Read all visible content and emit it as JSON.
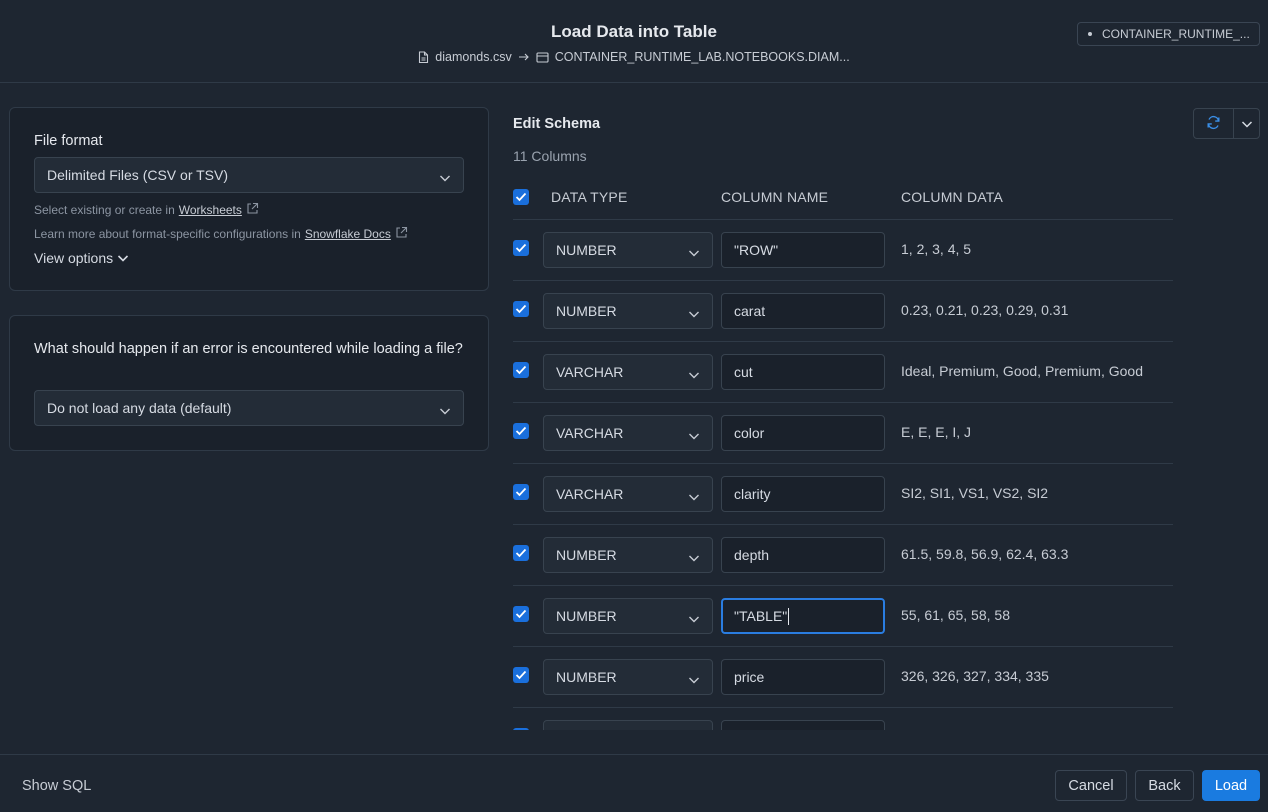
{
  "header": {
    "title": "Load Data into Table",
    "source_file": "diamonds.csv",
    "target_table": "CONTAINER_RUNTIME_LAB.NOTEBOOKS.DIAM...",
    "context_chip": "CONTAINER_RUNTIME_..."
  },
  "file_format": {
    "label": "File format",
    "selected": "Delimited Files (CSV or TSV)",
    "help1_prefix": "Select existing or create in",
    "help1_link": "Worksheets",
    "help2_prefix": "Learn more about format-specific configurations in",
    "help2_link": "Snowflake Docs",
    "view_options": "View options"
  },
  "error_handling": {
    "label": "What should happen if an error is encountered while loading a file?",
    "selected": "Do not load any data (default)"
  },
  "schema": {
    "title": "Edit Schema",
    "column_count": "11 Columns",
    "headers": {
      "data_type": "DATA TYPE",
      "column_name": "COLUMN NAME",
      "column_data": "COLUMN DATA"
    },
    "rows": [
      {
        "type": "NUMBER",
        "name": "\"ROW\"",
        "data": "1, 2, 3, 4, 5"
      },
      {
        "type": "NUMBER",
        "name": "carat",
        "data": "0.23, 0.21, 0.23, 0.29, 0.31"
      },
      {
        "type": "VARCHAR",
        "name": "cut",
        "data": "Ideal, Premium, Good, Premium, Good"
      },
      {
        "type": "VARCHAR",
        "name": "color",
        "data": "E, E, E, I, J"
      },
      {
        "type": "VARCHAR",
        "name": "clarity",
        "data": "SI2, SI1, VS1, VS2, SI2"
      },
      {
        "type": "NUMBER",
        "name": "depth",
        "data": "61.5, 59.8, 56.9, 62.4, 63.3"
      },
      {
        "type": "NUMBER",
        "name": "\"TABLE\"",
        "data": "55, 61, 65, 58, 58"
      },
      {
        "type": "NUMBER",
        "name": "price",
        "data": "326, 326, 327, 334, 335"
      },
      {
        "type": "",
        "name": "",
        "data": ""
      }
    ]
  },
  "footer": {
    "show_sql": "Show SQL",
    "cancel": "Cancel",
    "back": "Back",
    "load": "Load"
  },
  "colors": {
    "background": "#1e2631",
    "panel": "#1a212b",
    "accent": "#1a7be0",
    "border": "#2f3a47"
  }
}
